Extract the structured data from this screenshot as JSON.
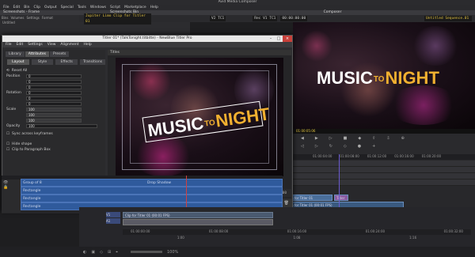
{
  "app": {
    "title": "Avid Media Composer"
  },
  "menubar": {
    "items": [
      "File",
      "Edit",
      "Bin",
      "Clip",
      "Output",
      "Special",
      "Tools",
      "Windows",
      "Script",
      "Marketplace",
      "Help"
    ]
  },
  "bin": {
    "tab1": "Screenshots - Frame",
    "tab2": "Screenshots Bin",
    "toolbar": [
      "Bins",
      "Volumes",
      "Settings",
      "Format"
    ],
    "items": [
      "Untitled",
      "Untitled"
    ],
    "clip": "NB Titler Pro"
  },
  "composer": {
    "title": "Composer",
    "source_clip": "Jupiter Limo Clip for Titler 01",
    "record_seq": "Untitled Sequence.01",
    "tc_left": "V2 TC1",
    "tc_mid": "Rec V1 TC1",
    "tc_right": "00:00:00:00",
    "rec_tc": "01:00:00:00",
    "mas_label": "Mas",
    "tc_bottom": "01:00:05:06"
  },
  "video": {
    "music": "MUSIC",
    "to": "TO",
    "night": "NIGHT"
  },
  "titler": {
    "window_title": "Titler 01* (TalkTonight.titbitte) - NewBlue Titler Pro",
    "menu": [
      "File",
      "Edit",
      "Settings",
      "View",
      "Alignment",
      "Help"
    ],
    "tabs": [
      "Library",
      "Attributes",
      "Presets"
    ],
    "subtabs": [
      "Layout",
      "Style",
      "Effects",
      "Transitions"
    ],
    "params": [
      {
        "label": "Reset All",
        "value": ""
      },
      {
        "label": "Position",
        "value": "0"
      },
      {
        "label": "",
        "value": "0"
      },
      {
        "label": "",
        "value": "0"
      },
      {
        "label": "Rotation",
        "value": "0"
      },
      {
        "label": "",
        "value": "0"
      },
      {
        "label": "",
        "value": "0"
      },
      {
        "label": "Scale",
        "value": "100"
      },
      {
        "label": "",
        "value": "100"
      },
      {
        "label": "",
        "value": "100"
      },
      {
        "label": "Opacity",
        "value": "100"
      }
    ],
    "check1": "Sync across keyframes",
    "check2": "Hide shape",
    "check3": "Clip to Paragraph Box",
    "preview_header": "Titles",
    "tc_start": "00:00:00:00",
    "tc_current": "00:00:00:20",
    "tc_end": "00:00:10:00",
    "add_paragraph": "Add Paragraph",
    "add_shape": "Add Shape",
    "shapes": "Shapes",
    "tracks": [
      "Group of 8",
      "Rectangle",
      "Rectangle",
      "Rectangle"
    ],
    "track_bar": "Drop Shadow",
    "zoom": "100%"
  },
  "timeline": {
    "ruler": [
      "01:00:00:00",
      "01:00:04:00",
      "01:00:08:00",
      "01:00:12:00",
      "01:00:16:00",
      "01:00:20:00",
      "01:00:24:00"
    ],
    "tc_display": "01:00:05:06",
    "clips": [
      "Clip for Titler 01",
      "Clip for Titler 01 (00:01 FPS)",
      "Clip for Titler 01 (00:01 FPS)"
    ],
    "tracks": [
      "V2",
      "V1",
      "A1",
      "A2",
      "TC1"
    ],
    "clip_small": "Titler",
    "lower_ruler": [
      "00:00",
      "01:00:00:00",
      "01:00:08:00",
      "01:00:16:00",
      "01:00:24:00",
      "01:00:32:00"
    ],
    "bottom": [
      "1:00",
      "1:08",
      "1:16"
    ]
  },
  "colors": {
    "accent": "#f0b030",
    "track_blue": "#2f5a9c",
    "tc_yellow": "#e0c040"
  }
}
